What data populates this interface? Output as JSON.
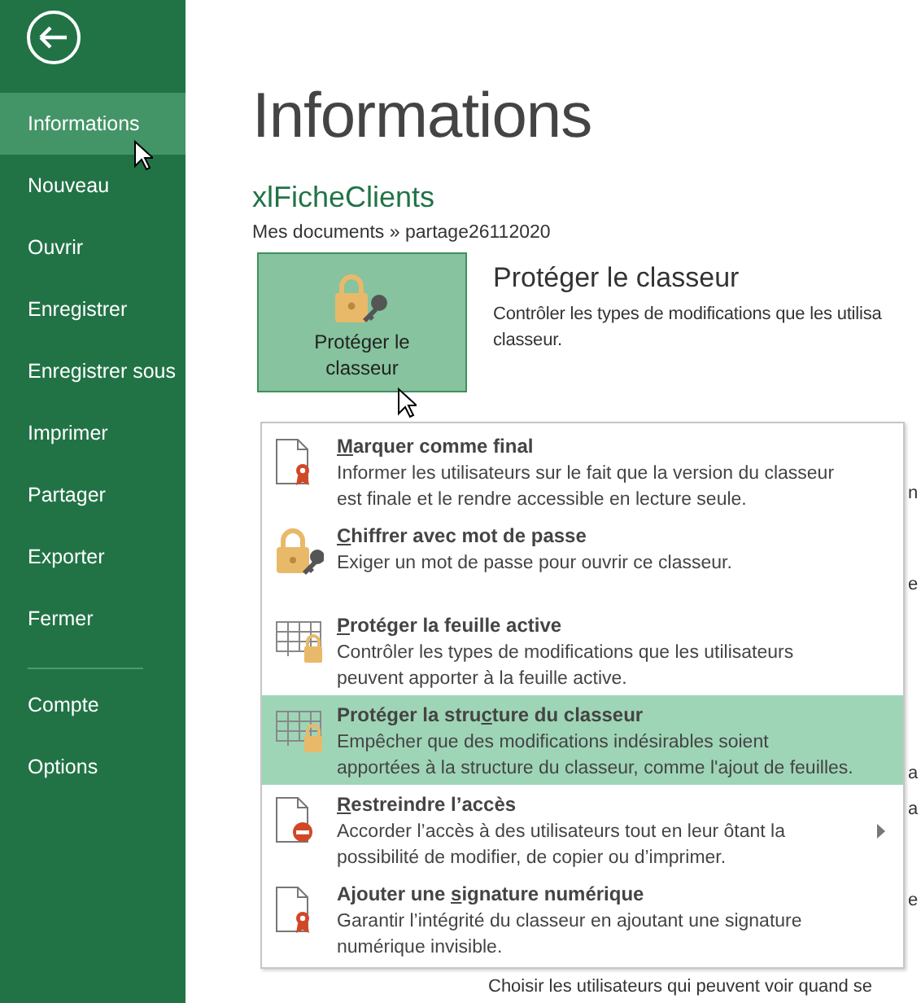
{
  "sidebar": {
    "items": [
      {
        "label": "Informations",
        "selected": true
      },
      {
        "label": "Nouveau",
        "selected": false
      },
      {
        "label": "Ouvrir",
        "selected": false
      },
      {
        "label": "Enregistrer",
        "selected": false
      },
      {
        "label": "Enregistrer sous",
        "selected": false
      },
      {
        "label": "Imprimer",
        "selected": false
      },
      {
        "label": "Partager",
        "selected": false
      },
      {
        "label": "Exporter",
        "selected": false
      },
      {
        "label": "Fermer",
        "selected": false
      }
    ],
    "footer_items": [
      {
        "label": "Compte",
        "selected": false
      },
      {
        "label": "Options",
        "selected": false
      }
    ]
  },
  "page": {
    "title": "Informations",
    "file_name": "xlFicheClients",
    "path": "Mes documents » partage26112020"
  },
  "protect": {
    "button_label": "Protéger le classeur",
    "heading": "Protéger le classeur",
    "description": "Contrôler les types de modifications que les utilisa",
    "description_2": "classeur."
  },
  "behind": {
    "fragments": [
      "n",
      "e",
      "a",
      "a",
      "e"
    ],
    "bottom_line": "Choisir les utilisateurs qui peuvent voir quand se"
  },
  "menu": {
    "items": [
      {
        "kind": "final",
        "title": [
          {
            "text": "M",
            "underline": true
          },
          {
            "text": "arquer comme final",
            "underline": false
          }
        ],
        "description": [
          "Informer les utilisateurs sur le fait que la version du classeur",
          "est finale et le rendre accessible en lecture seule."
        ],
        "selected": false,
        "submenu": false
      },
      {
        "kind": "encrypt",
        "title": [
          {
            "text": "C",
            "underline": true
          },
          {
            "text": "hiffrer avec mot de passe",
            "underline": false
          }
        ],
        "description": [
          "Exiger un mot de passe pour ouvrir ce classeur."
        ],
        "selected": false,
        "submenu": false
      },
      {
        "kind": "sheet",
        "title": [
          {
            "text": "P",
            "underline": true
          },
          {
            "text": "rotéger la feuille active",
            "underline": false
          }
        ],
        "description": [
          "Contrôler les types de modifications que les utilisateurs",
          "peuvent apporter à la feuille active."
        ],
        "selected": false,
        "submenu": false
      },
      {
        "kind": "sheet",
        "title": [
          {
            "text": "Protéger la stru",
            "underline": false
          },
          {
            "text": "c",
            "underline": true
          },
          {
            "text": "ture du classeur",
            "underline": false
          }
        ],
        "description": [
          "Empêcher que des modifications indésirables soient",
          "apportées à la structure du classeur, comme l'ajout de feuilles."
        ],
        "selected": true,
        "submenu": false
      },
      {
        "kind": "restrict",
        "title": [
          {
            "text": "R",
            "underline": true
          },
          {
            "text": "estreindre l’accès",
            "underline": false
          }
        ],
        "description": [
          "Accorder l’accès à des utilisateurs tout en leur ôtant la",
          "possibilité de modifier, de copier ou d’imprimer."
        ],
        "selected": false,
        "submenu": true
      },
      {
        "kind": "final",
        "title": [
          {
            "text": "Ajouter une ",
            "underline": false
          },
          {
            "text": "s",
            "underline": true
          },
          {
            "text": "ignature numérique",
            "underline": false
          }
        ],
        "description": [
          "Garantir l’intégrité du classeur en ajoutant une signature",
          "numérique invisible."
        ],
        "selected": false,
        "submenu": false
      }
    ]
  }
}
